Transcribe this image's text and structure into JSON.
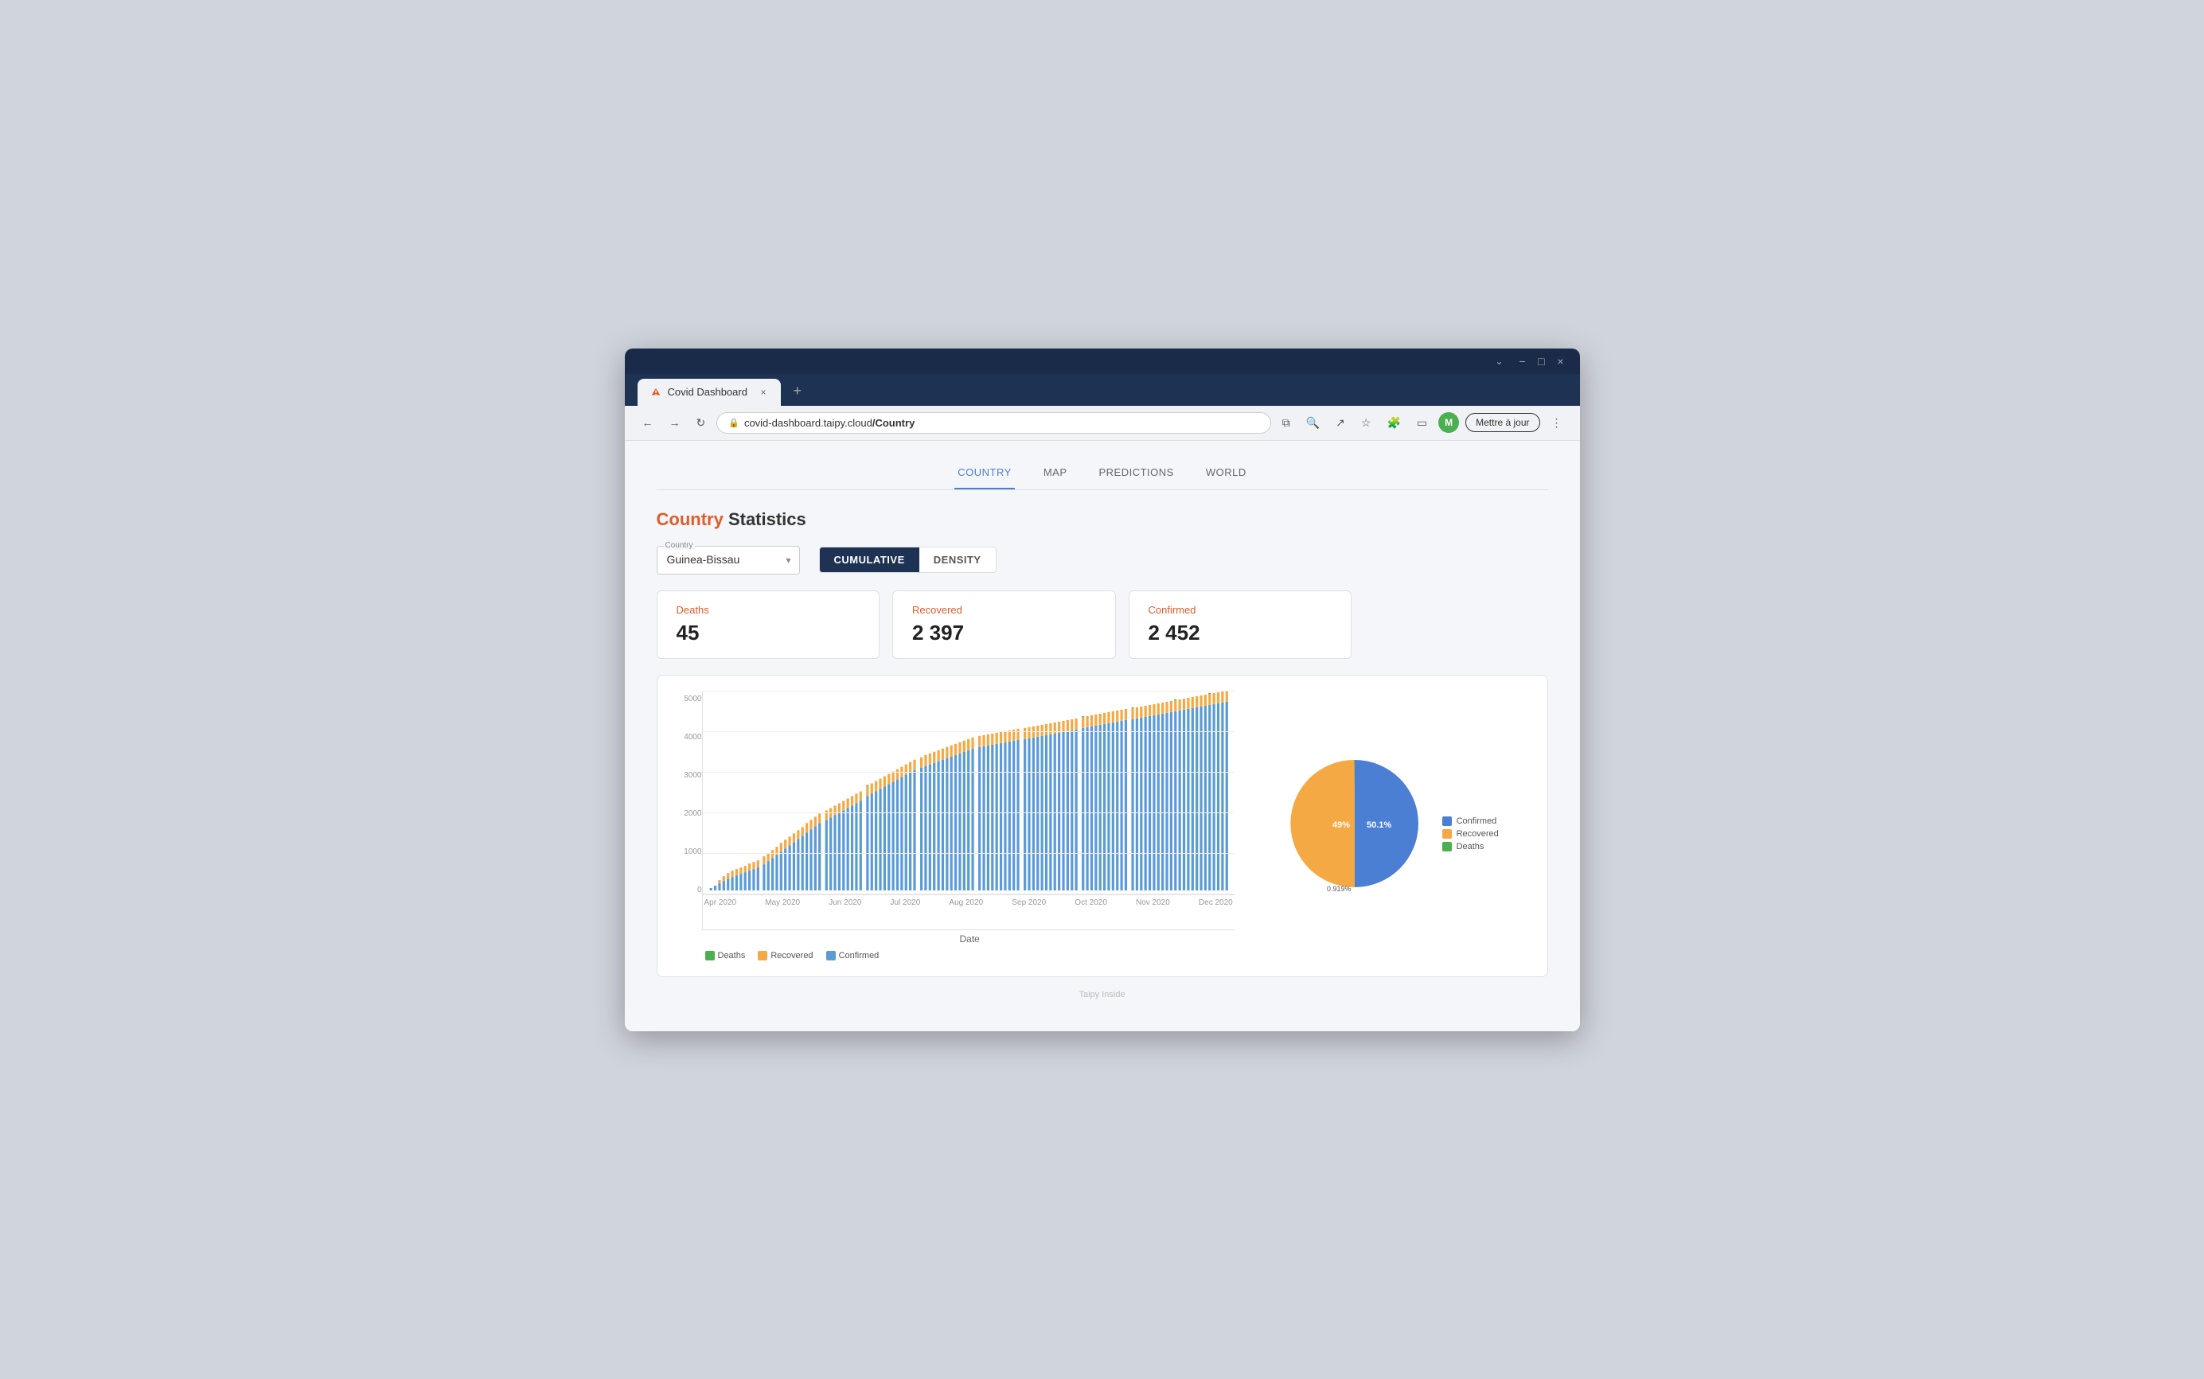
{
  "browser": {
    "tab_title": "Covid Dashboard",
    "tab_close": "×",
    "tab_new": "+",
    "url_protocol": "covid-dashboard.taipy.cloud",
    "url_path": "/Country",
    "back_btn": "←",
    "forward_btn": "→",
    "refresh_btn": "↻",
    "update_btn": "Mettre à jour",
    "more_btn": "⋮",
    "window_minimize": "−",
    "window_maximize": "□",
    "window_close": "×"
  },
  "nav": {
    "items": [
      {
        "id": "country",
        "label": "COUNTRY",
        "active": true
      },
      {
        "id": "map",
        "label": "MAP",
        "active": false
      },
      {
        "id": "predictions",
        "label": "PREDICTIONS",
        "active": false
      },
      {
        "id": "world",
        "label": "WORLD",
        "active": false
      }
    ]
  },
  "page": {
    "title_highlight": "Country",
    "title_rest": " Statistics",
    "country_label": "Country",
    "country_value": "Guinea-Bissau",
    "toggle_cumulative": "CUMULATIVE",
    "toggle_density": "DENSITY"
  },
  "stats": {
    "deaths_label": "Deaths",
    "deaths_value": "45",
    "recovered_label": "Recovered",
    "recovered_value": "2 397",
    "confirmed_label": "Confirmed",
    "confirmed_value": "2 452"
  },
  "bar_chart": {
    "y_labels": [
      "0",
      "1000",
      "2000",
      "3000",
      "4000",
      "5000"
    ],
    "x_labels": [
      "Apr 2020",
      "May 2020",
      "Jun 2020",
      "Jul 2020",
      "Aug 2020",
      "Sep 2020",
      "Oct 2020",
      "Nov 2020",
      "Dec 2020"
    ],
    "x_title": "Date",
    "legend": [
      {
        "label": "Deaths",
        "color": "#4caf50"
      },
      {
        "label": "Recovered",
        "color": "#f4a944"
      },
      {
        "label": "Confirmed",
        "color": "#5b9bd5"
      }
    ]
  },
  "pie_chart": {
    "segments": [
      {
        "label": "Confirmed",
        "pct": 50.1,
        "color": "#4a7fd4"
      },
      {
        "label": "Recovered",
        "pct": 49.0,
        "color": "#f4a944"
      },
      {
        "label": "Deaths",
        "pct": 0.919,
        "color": "#4caf50"
      }
    ],
    "label_confirmed": "50.1%",
    "label_recovered": "49%",
    "label_deaths": "0.919%",
    "legend": [
      {
        "label": "Confirmed",
        "color": "#4a7fd4"
      },
      {
        "label": "Recovered",
        "color": "#f4a944"
      },
      {
        "label": "Deaths",
        "color": "#4caf50"
      }
    ]
  },
  "footer": {
    "text": "Taipy Inside"
  }
}
